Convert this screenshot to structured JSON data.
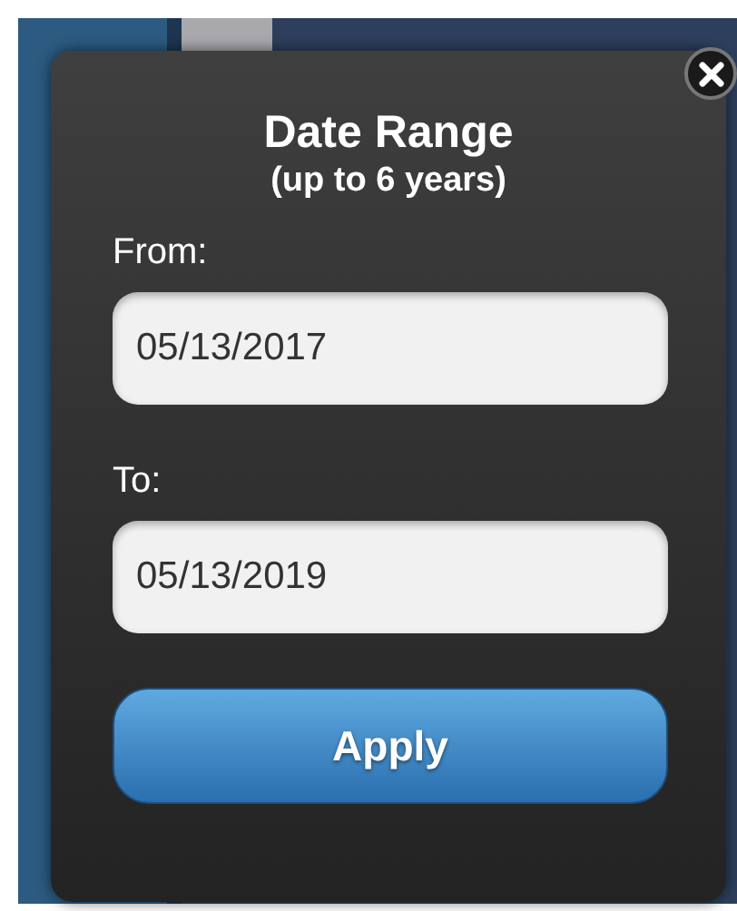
{
  "dialog": {
    "title": "Date Range",
    "subtitle": "(up to 6 years)",
    "fields": [
      {
        "label": "From:",
        "value": "05/13/2017"
      },
      {
        "label": "To:",
        "value": "05/13/2019"
      }
    ],
    "apply_button": "Apply"
  }
}
